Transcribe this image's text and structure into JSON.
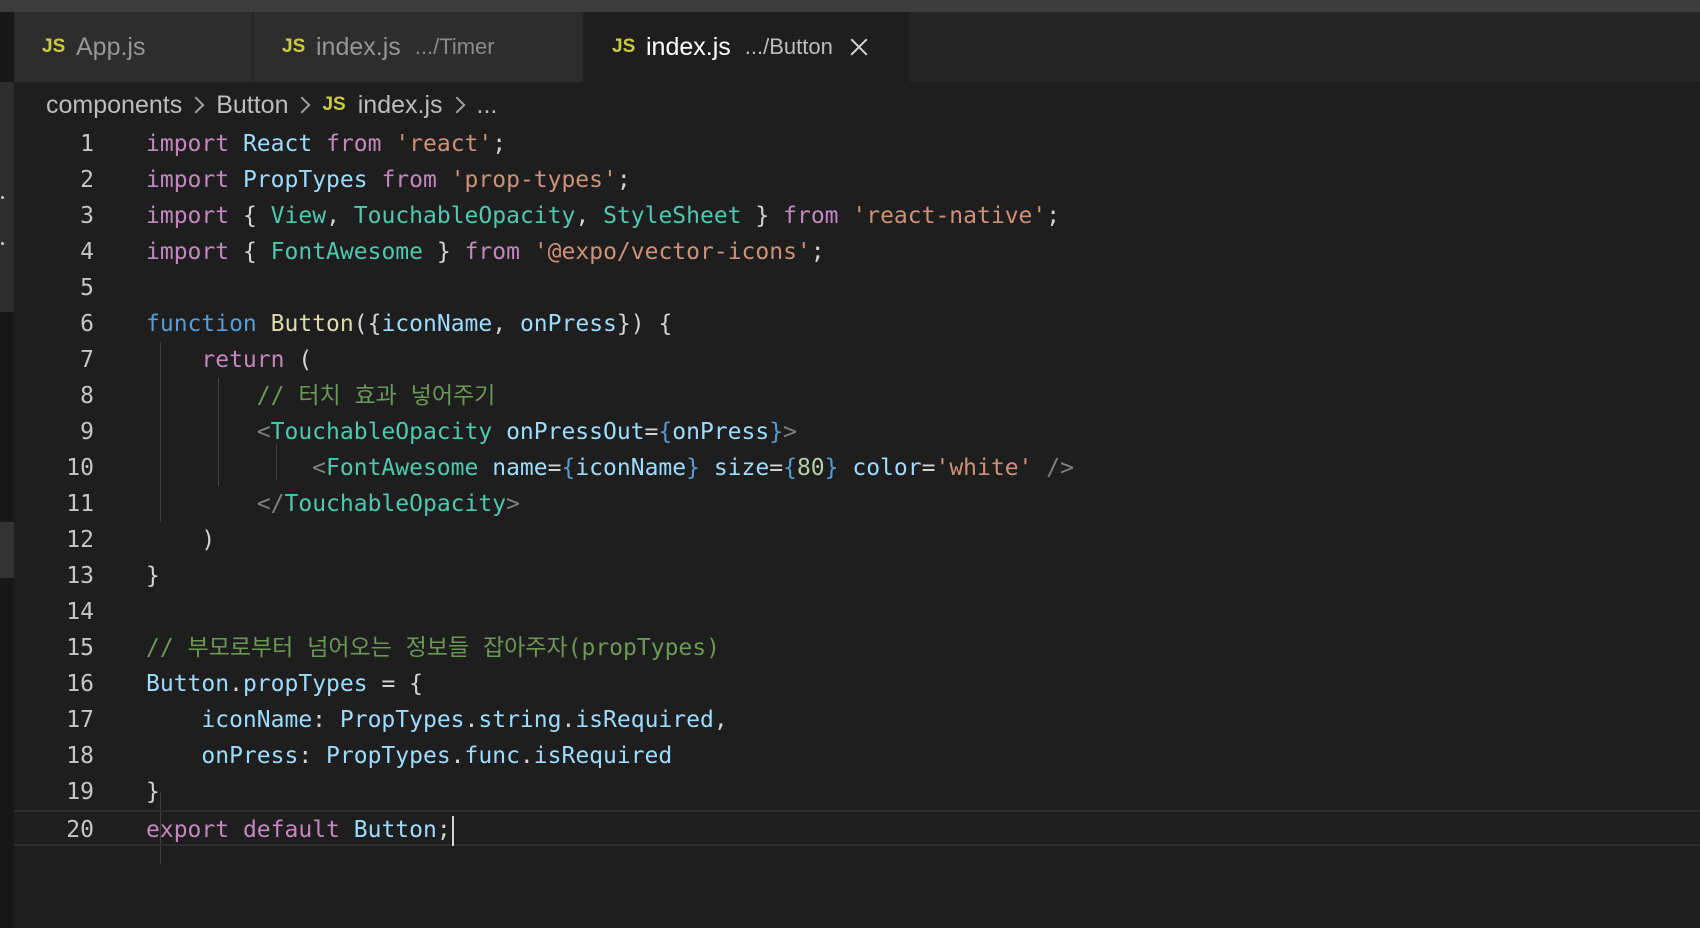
{
  "tabs": [
    {
      "icon": "JS",
      "name": "App.js",
      "desc": "",
      "active": false
    },
    {
      "icon": "JS",
      "name": "index.js",
      "desc": ".../Timer",
      "active": false
    },
    {
      "icon": "JS",
      "name": "index.js",
      "desc": ".../Button",
      "active": true
    }
  ],
  "breadcrumb": [
    "components",
    "Button",
    "index.js",
    "..."
  ],
  "breadcrumb_file_icon": "JS",
  "colors": {
    "keyword": "#c586c0",
    "declaration": "#569cd6",
    "variable": "#9cdcfe",
    "class": "#4ec9b0",
    "function": "#dcdcaa",
    "string": "#ce9178",
    "comment": "#6a9955",
    "number": "#b5cea8",
    "background": "#1e1e1e",
    "js_icon": "#cbcb41"
  },
  "code_lines": [
    {
      "n": "1",
      "text": "import React from 'react';"
    },
    {
      "n": "2",
      "text": "import PropTypes from 'prop-types';"
    },
    {
      "n": "3",
      "text": "import { View, TouchableOpacity, StyleSheet } from 'react-native';"
    },
    {
      "n": "4",
      "text": "import { FontAwesome } from '@expo/vector-icons';"
    },
    {
      "n": "5",
      "text": ""
    },
    {
      "n": "6",
      "text": "function Button({iconName, onPress}) {"
    },
    {
      "n": "7",
      "text": "    return ("
    },
    {
      "n": "8",
      "text": "        // 터치 효과 넣어주기"
    },
    {
      "n": "9",
      "text": "        <TouchableOpacity onPressOut={onPress}>"
    },
    {
      "n": "10",
      "text": "            <FontAwesome name={iconName} size={80} color='white' />"
    },
    {
      "n": "11",
      "text": "        </TouchableOpacity>"
    },
    {
      "n": "12",
      "text": "    )"
    },
    {
      "n": "13",
      "text": "}"
    },
    {
      "n": "14",
      "text": ""
    },
    {
      "n": "15",
      "text": "// 부모로부터 넘어오는 정보들 잡아주자(propTypes)"
    },
    {
      "n": "16",
      "text": "Button.propTypes = {"
    },
    {
      "n": "17",
      "text": "    iconName: PropTypes.string.isRequired,"
    },
    {
      "n": "18",
      "text": "    onPress: PropTypes.func.isRequired"
    },
    {
      "n": "19",
      "text": "}"
    },
    {
      "n": "20",
      "text": "export default Button;"
    }
  ],
  "current_line": "20"
}
